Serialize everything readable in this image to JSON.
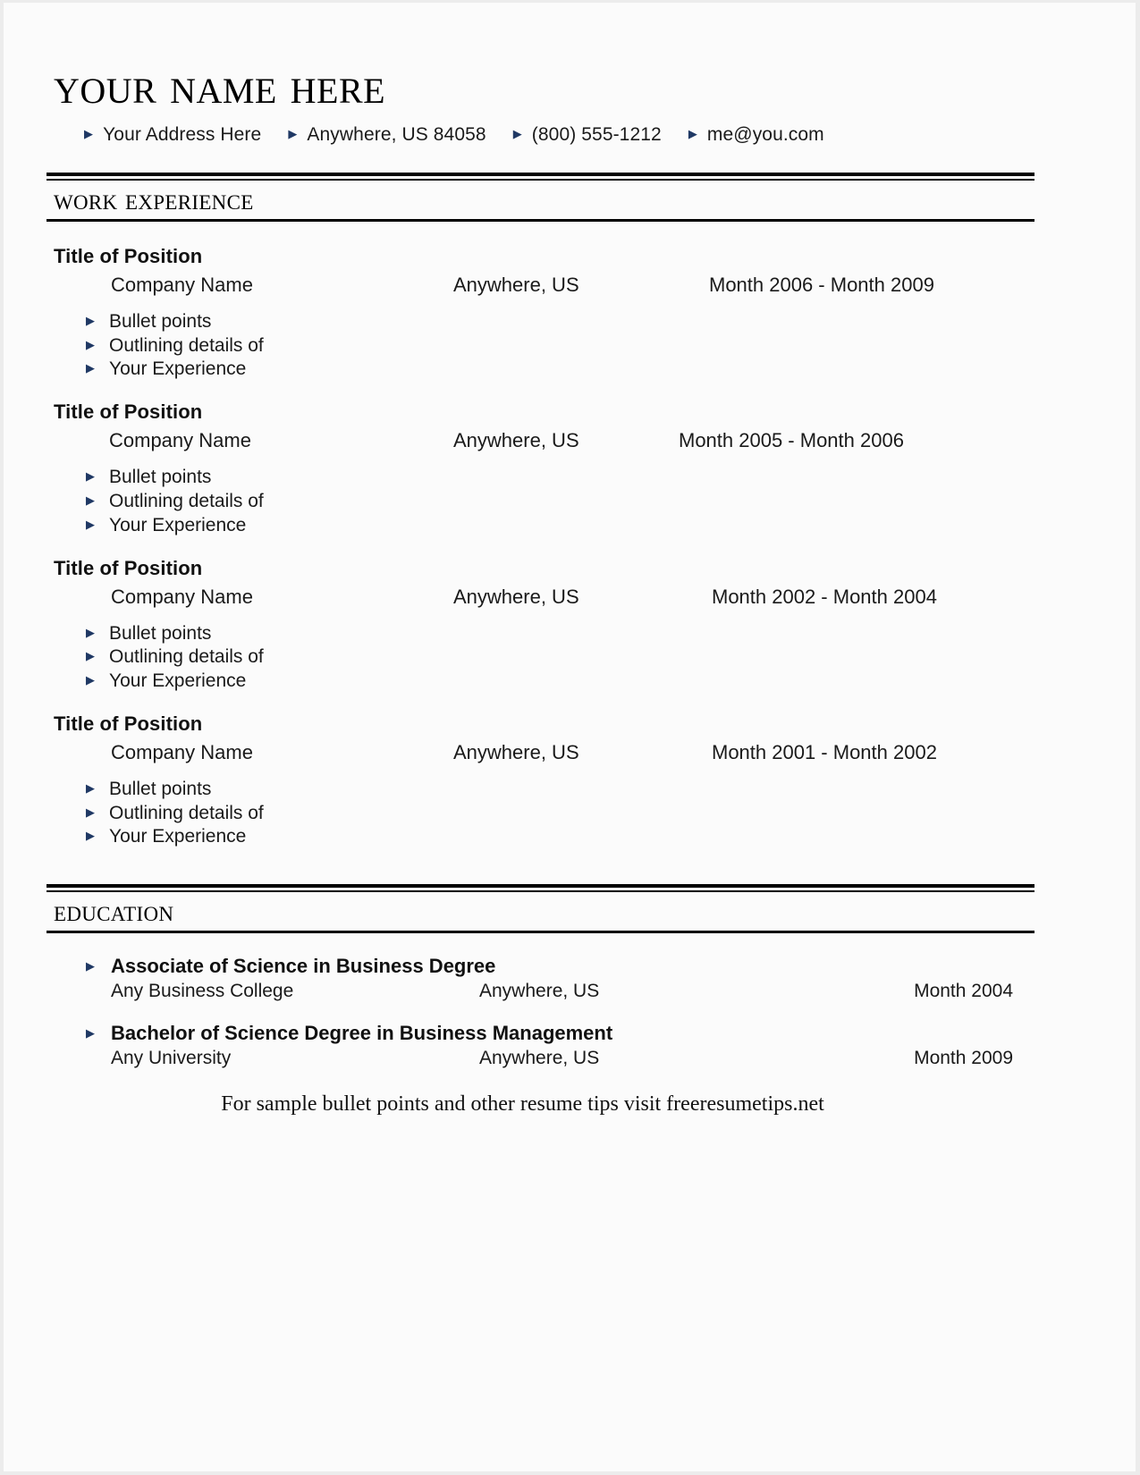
{
  "header": {
    "name": "Your Name Here",
    "contact": [
      {
        "bullet": "triangle-bullet-icon",
        "text": "Your Address Here"
      },
      {
        "bullet": "triangle-bullet-icon",
        "text": "Anywhere, US 84058"
      },
      {
        "bullet": "triangle-bullet-icon",
        "text": "(800) 555-1212"
      },
      {
        "bullet": "triangle-bullet-icon",
        "text": "me@you.com"
      }
    ]
  },
  "colors": {
    "bullet_navy": "#1f3864",
    "text": "#1a1a1a",
    "rule": "#000000",
    "page_bg": "#fbfbfb"
  },
  "work": {
    "section_title": "Work Experience",
    "jobs": [
      {
        "title": "Title of Position",
        "company": "Company Name",
        "location": "Anywhere, US",
        "dates": "Month 2006 - Month 2009",
        "bullets": [
          "Bullet points",
          "Outlining details of",
          "Your Experience"
        ]
      },
      {
        "title": "Title of Position",
        "company": "Company Name",
        "location": "Anywhere, US",
        "dates": "Month 2005 - Month 2006",
        "bullets": [
          "Bullet points",
          "Outlining details of",
          "Your Experience"
        ]
      },
      {
        "title": "Title of Position",
        "company": "Company Name",
        "location": "Anywhere, US",
        "dates": "Month 2002 - Month 2004",
        "bullets": [
          "Bullet points",
          "Outlining details of",
          "Your Experience"
        ]
      },
      {
        "title": "Title of Position",
        "company": "Company Name",
        "location": "Anywhere, US",
        "dates": "Month 2001 - Month 2002",
        "bullets": [
          "Bullet points",
          "Outlining details of",
          "Your Experience"
        ]
      }
    ]
  },
  "education": {
    "section_title": "Education",
    "entries": [
      {
        "degree": "Associate of Science in Business Degree",
        "school": "Any Business College",
        "location": "Anywhere, US",
        "date": "Month 2004"
      },
      {
        "degree": "Bachelor of Science Degree in Business Management",
        "school": "Any University",
        "location": "Anywhere, US",
        "date": "Month 2009"
      }
    ]
  },
  "footer": {
    "tip": "For sample bullet points and other resume tips visit freeresumetips.net"
  }
}
